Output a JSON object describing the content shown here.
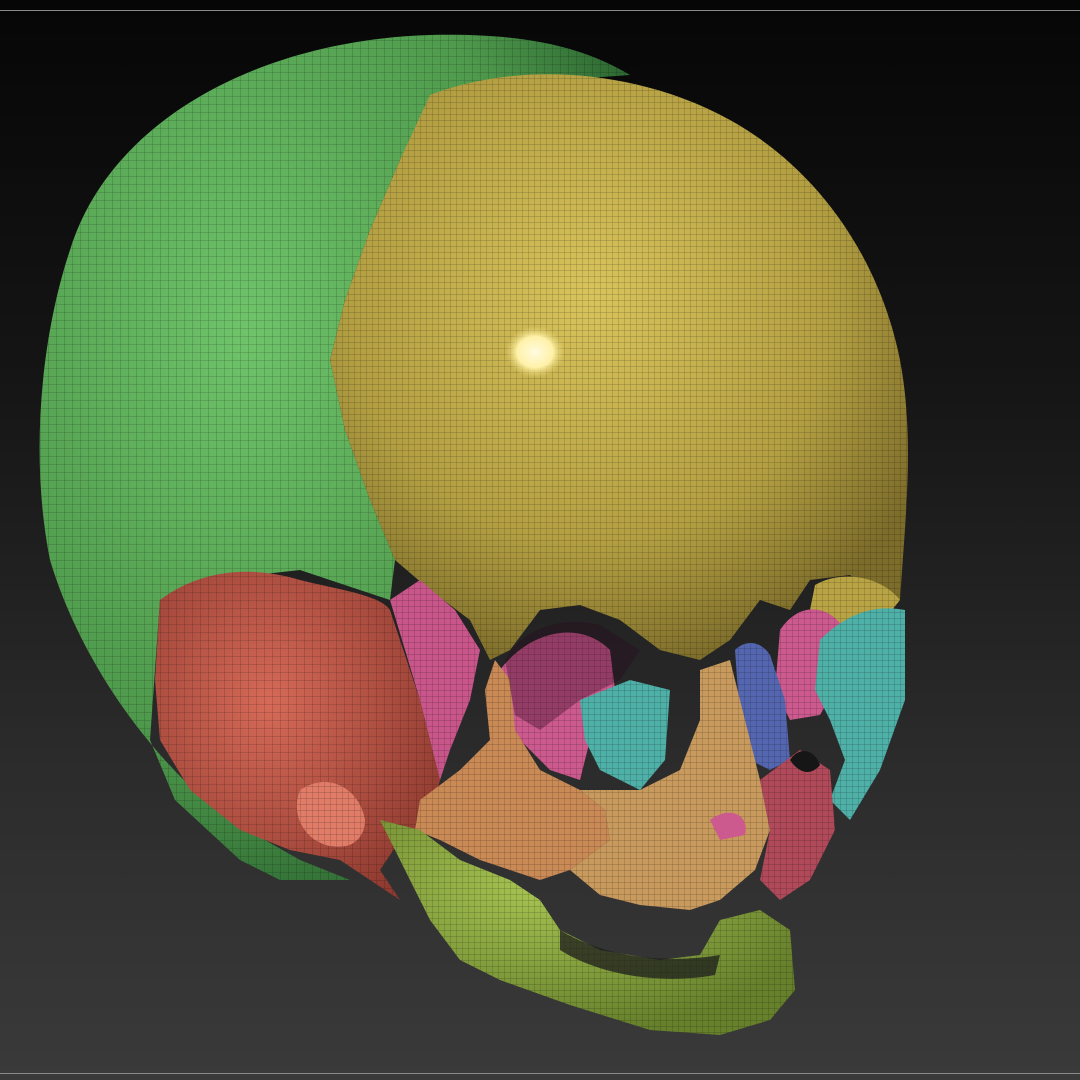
{
  "viewport": {
    "background_top": "#060606",
    "background_bottom": "#3a3a3a",
    "rule_color": "#8a8a8a"
  },
  "model": {
    "subject": "segmented-skull-wireframe-mesh",
    "palette": {
      "parietal": "#5faf5a",
      "frontal": "#b9a445",
      "temporal": "#c0584a",
      "sphenoid": "#c9568a",
      "zygomatic": "#c98a56",
      "maxilla": "#c89a5e",
      "mandible": "#8fb040",
      "ethmoid": "#cc5a8e",
      "lacrimal": "#4fb0a8",
      "nasal": "#5566b0",
      "vomer": "#b04a5a",
      "highlight": "#fff1a8"
    }
  }
}
